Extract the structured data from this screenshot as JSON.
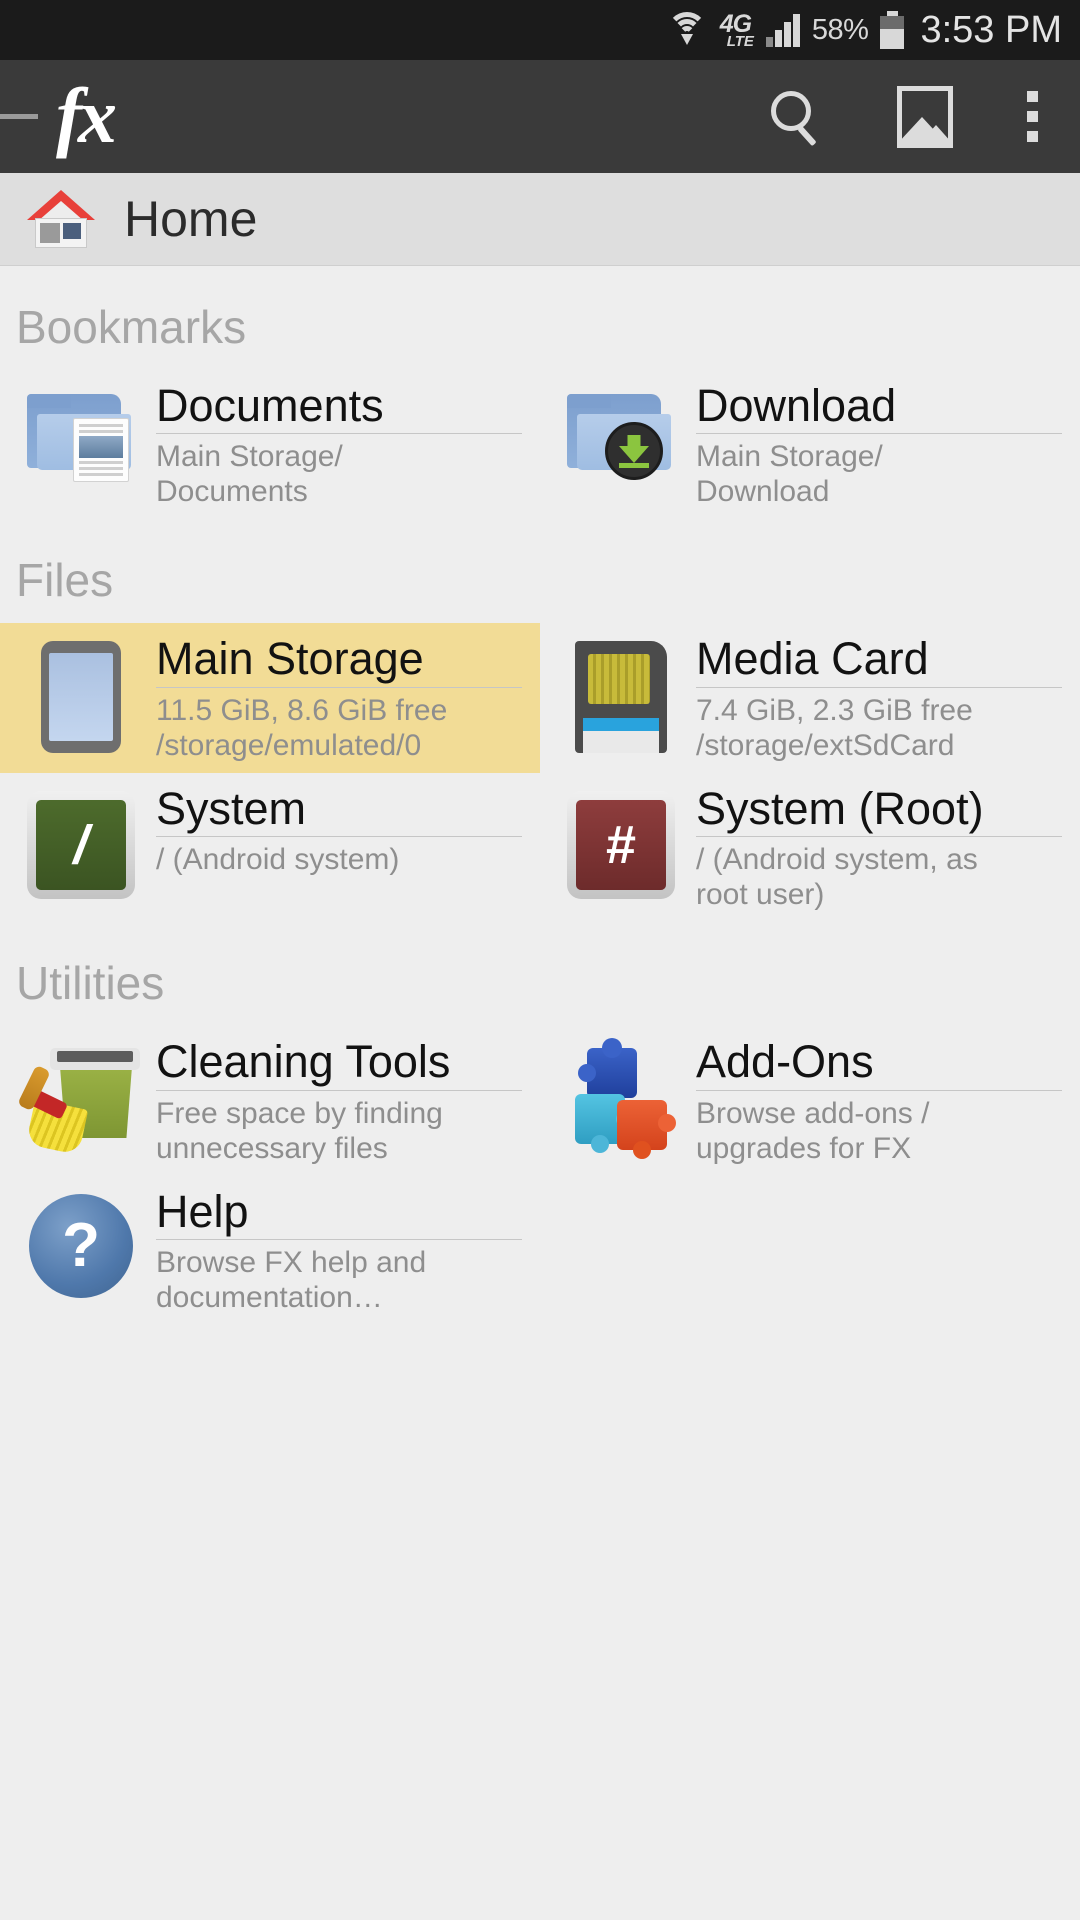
{
  "statusbar": {
    "network_label_top": "4G",
    "network_label_bottom": "LTE",
    "battery_percent": "58%",
    "clock": "3:53 PM",
    "wifi_icon": "wifi-icon",
    "signal_icon": "signal-bars-icon",
    "battery_icon": "battery-icon"
  },
  "appbar": {
    "logo": "fx",
    "search_icon": "search-icon",
    "image_icon": "image-icon",
    "overflow_icon": "overflow-menu-icon"
  },
  "breadcrumb": {
    "icon": "home-icon",
    "label": "Home"
  },
  "sections": [
    {
      "title": "Bookmarks",
      "items": [
        {
          "title": "Documents",
          "subtitle": "Main Storage/\nDocuments",
          "icon": "folder-documents-icon",
          "highlighted": false
        },
        {
          "title": "Download",
          "subtitle": "Main Storage/\nDownload",
          "icon": "folder-download-icon",
          "highlighted": false
        }
      ]
    },
    {
      "title": "Files",
      "items": [
        {
          "title": "Main Storage",
          "subtitle": "11.5 GiB, 8.6 GiB free\n/storage/emulated/0",
          "icon": "phone-storage-icon",
          "highlighted": true
        },
        {
          "title": "Media Card",
          "subtitle": "7.4 GiB, 2.3 GiB free\n/storage/extSdCard",
          "icon": "sd-card-icon",
          "highlighted": false
        },
        {
          "title": "System",
          "subtitle": "/ (Android system)",
          "icon": "root-slash-icon",
          "glyph": "/",
          "highlighted": false
        },
        {
          "title": "System (Root)",
          "subtitle": "/ (Android system, as\nroot user)",
          "icon": "root-hash-icon",
          "glyph": "#",
          "highlighted": false
        }
      ]
    },
    {
      "title": "Utilities",
      "items": [
        {
          "title": "Cleaning Tools",
          "subtitle": "Free space by finding\nunnecessary files",
          "icon": "broom-bin-icon",
          "highlighted": false
        },
        {
          "title": "Add-Ons",
          "subtitle": "Browse add-ons /\nupgrades for FX",
          "icon": "puzzle-pieces-icon",
          "highlighted": false
        },
        {
          "title": "Help",
          "subtitle": "Browse FX help and\ndocumentation…",
          "icon": "help-question-icon",
          "glyph": "?",
          "highlighted": false
        }
      ]
    }
  ],
  "colors": {
    "statusbar_bg": "#1b1b1b",
    "appbar_bg": "#3a3a3a",
    "breadcrumb_bg": "#dedede",
    "page_bg": "#eeeeee",
    "highlight": "#f2dc96",
    "title_text": "#121212",
    "subtitle_text": "#8e8e8e",
    "section_text": "#a6a6a6"
  }
}
